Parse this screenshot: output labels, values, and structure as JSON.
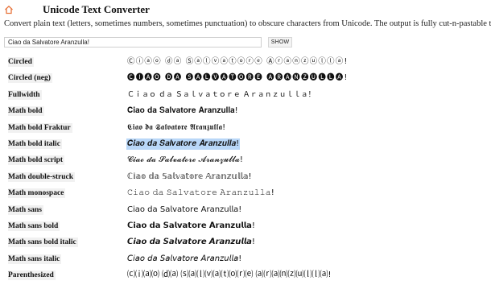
{
  "header": {
    "title": "Unicode Text Converter",
    "home_icon": "home-icon",
    "accent": "#e8743b"
  },
  "description": "Convert plain text (letters, sometimes numbers, sometimes punctuation) to obscure characters from Unicode. The output is fully cut-n-pastable text.",
  "form": {
    "input_value": "Ciao da Salvatore Aranzulla!",
    "show_label": "SHOW"
  },
  "rows": [
    {
      "label": "Circled",
      "value": "Ⓒⓘⓐⓞ ⓓⓐ Ⓢⓐⓛⓥⓐⓣⓞⓡⓔ Ⓐⓡⓐⓝⓩⓤⓛⓛⓐ!"
    },
    {
      "label": "Circled (neg)",
      "value": "🅒🅘🅐🅞 🅓🅐 🅢🅐🅛🅥🅐🅣🅞🅡🅔 🅐🅡🅐🅝🅩🅤🅛🅛🅐!"
    },
    {
      "label": "Fullwidth",
      "value": "Ｃｉａｏ ｄａ Ｓａｌｖａｔｏｒｅ Ａｒａｎｚｕｌｌａ！"
    },
    {
      "label": "Math bold",
      "value": "𝐂𝐢𝐚𝐨 𝐝𝐚 𝐒𝐚𝐥𝐯𝐚𝐭𝐨𝐫𝐞 𝐀𝐫𝐚𝐧𝐳𝐮𝐥𝐥𝐚!"
    },
    {
      "label": "Math bold Fraktur",
      "value": "𝕮𝖎𝖆𝖔 𝖉𝖆 𝕾𝖆𝖑𝖛𝖆𝖙𝖔𝖗𝖊 𝕬𝖗𝖆𝖓𝖟𝖚𝖑𝖑𝖆!"
    },
    {
      "label": "Math bold italic",
      "value": "𝑪𝒊𝒂𝒐 𝒅𝒂 𝑺𝒂𝒍𝒗𝒂𝒕𝒐𝒓𝒆 𝑨𝒓𝒂𝒏𝒛𝒖𝒍𝒍𝒂!",
      "selected": true
    },
    {
      "label": "Math bold script",
      "value": "𝓒𝓲𝓪𝓸 𝓭𝓪 𝓢𝓪𝓵𝓿𝓪𝓽𝓸𝓻𝓮 𝓐𝓻𝓪𝓷𝔃𝓾𝓵𝓵𝓪!"
    },
    {
      "label": "Math double-struck",
      "value": "ℂ𝕚𝕒𝕠 𝕕𝕒 𝕊𝕒𝕝𝕧𝕒𝕥𝕠𝕣𝕖 𝔸𝕣𝕒𝕟𝕫𝕦𝕝𝕝𝕒!"
    },
    {
      "label": "Math monospace",
      "value": "𝙲𝚒𝚊𝚘 𝚍𝚊 𝚂𝚊𝚕𝚟𝚊𝚝𝚘𝚛𝚎 𝙰𝚛𝚊𝚗𝚣𝚞𝚕𝚕𝚊!"
    },
    {
      "label": "Math sans",
      "value": "𝖢𝗂𝖺𝗈 𝖽𝖺 𝖲𝖺𝗅𝗏𝖺𝗍𝗈𝗋𝖾 𝖠𝗋𝖺𝗇𝗓𝗎𝗅𝗅𝖺!"
    },
    {
      "label": "Math sans bold",
      "value": "𝗖𝗶𝗮𝗼 𝗱𝗮 𝗦𝗮𝗹𝘃𝗮𝘁𝗼𝗿𝗲 𝗔𝗿𝗮𝗻𝘇𝘂𝗹𝗹𝗮!"
    },
    {
      "label": "Math sans bold italic",
      "value": "𝘾𝙞𝙖𝙤 𝙙𝙖 𝙎𝙖𝙡𝙫𝙖𝙩𝙤𝙧𝙚 𝘼𝙧𝙖𝙣𝙯𝙪𝙡𝙡𝙖!"
    },
    {
      "label": "Math sans italic",
      "value": "𝘊𝘪𝘢𝘰 𝘥𝘢 𝘚𝘢𝘭𝘷𝘢𝘵𝘰𝘳𝘦 𝘈𝘳𝘢𝘯𝘻𝘶𝘭𝘭𝘢!"
    },
    {
      "label": "Parenthesized",
      "value": "⒞⒤⒜⒪ ⒟⒜ ⒮⒜⒧⒱⒜⒯⒪⒭⒠ ⒜⒭⒜⒩⒵⒰⒧⒧⒜!"
    }
  ]
}
